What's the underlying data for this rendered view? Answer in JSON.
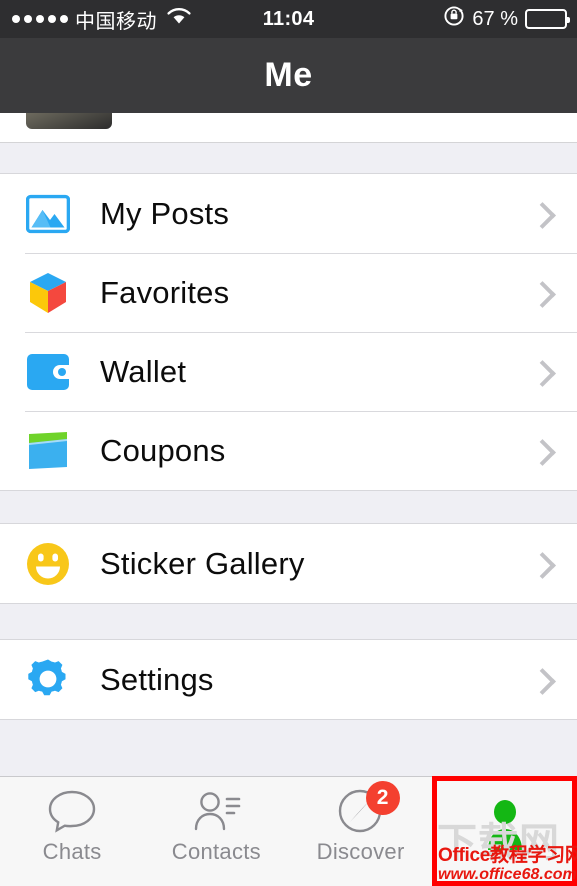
{
  "statusbar": {
    "signal_dots": 5,
    "carrier": "中国移动",
    "wifi_icon": "wifi-icon",
    "time": "11:04",
    "rotation_lock_icon": "rotation-lock-icon",
    "battery_text": "67 %",
    "battery_level": 67
  },
  "navbar": {
    "title": "Me"
  },
  "sections": [
    {
      "rows": [
        {
          "icon": "photos-icon",
          "label": "My Posts"
        },
        {
          "icon": "favorites-cube-icon",
          "label": "Favorites"
        },
        {
          "icon": "wallet-icon",
          "label": "Wallet"
        },
        {
          "icon": "coupons-icon",
          "label": "Coupons"
        }
      ]
    },
    {
      "rows": [
        {
          "icon": "sticker-smiley-icon",
          "label": "Sticker Gallery"
        }
      ]
    },
    {
      "rows": [
        {
          "icon": "settings-gear-icon",
          "label": "Settings"
        }
      ]
    }
  ],
  "tabbar": {
    "tabs": [
      {
        "icon": "chat-bubble-icon",
        "label": "Chats",
        "badge": "",
        "active": false
      },
      {
        "icon": "contacts-person-icon",
        "label": "Contacts",
        "badge": "",
        "active": false
      },
      {
        "icon": "compass-icon",
        "label": "Discover",
        "badge": "2",
        "active": false
      },
      {
        "icon": "person-filled-icon",
        "label": "",
        "badge": "",
        "active": true
      }
    ]
  },
  "annotation": {
    "highlight_color": "#ff0000"
  },
  "watermark": {
    "gray_text": "下载网",
    "red_line1": "Office教程学习网",
    "red_line2": "www.office68.com"
  },
  "colors": {
    "navbar_bg": "#3b3b3d",
    "statusbar_bg": "#2e2e30",
    "group_bg": "#ffffff",
    "page_bg": "#efeff4",
    "accent_blue": "#1aa9f0",
    "badge_red": "#f4402f",
    "active_green": "#1aad19",
    "chevron_gray": "#c3c3c7",
    "tab_label_gray": "#8a8a8f"
  }
}
